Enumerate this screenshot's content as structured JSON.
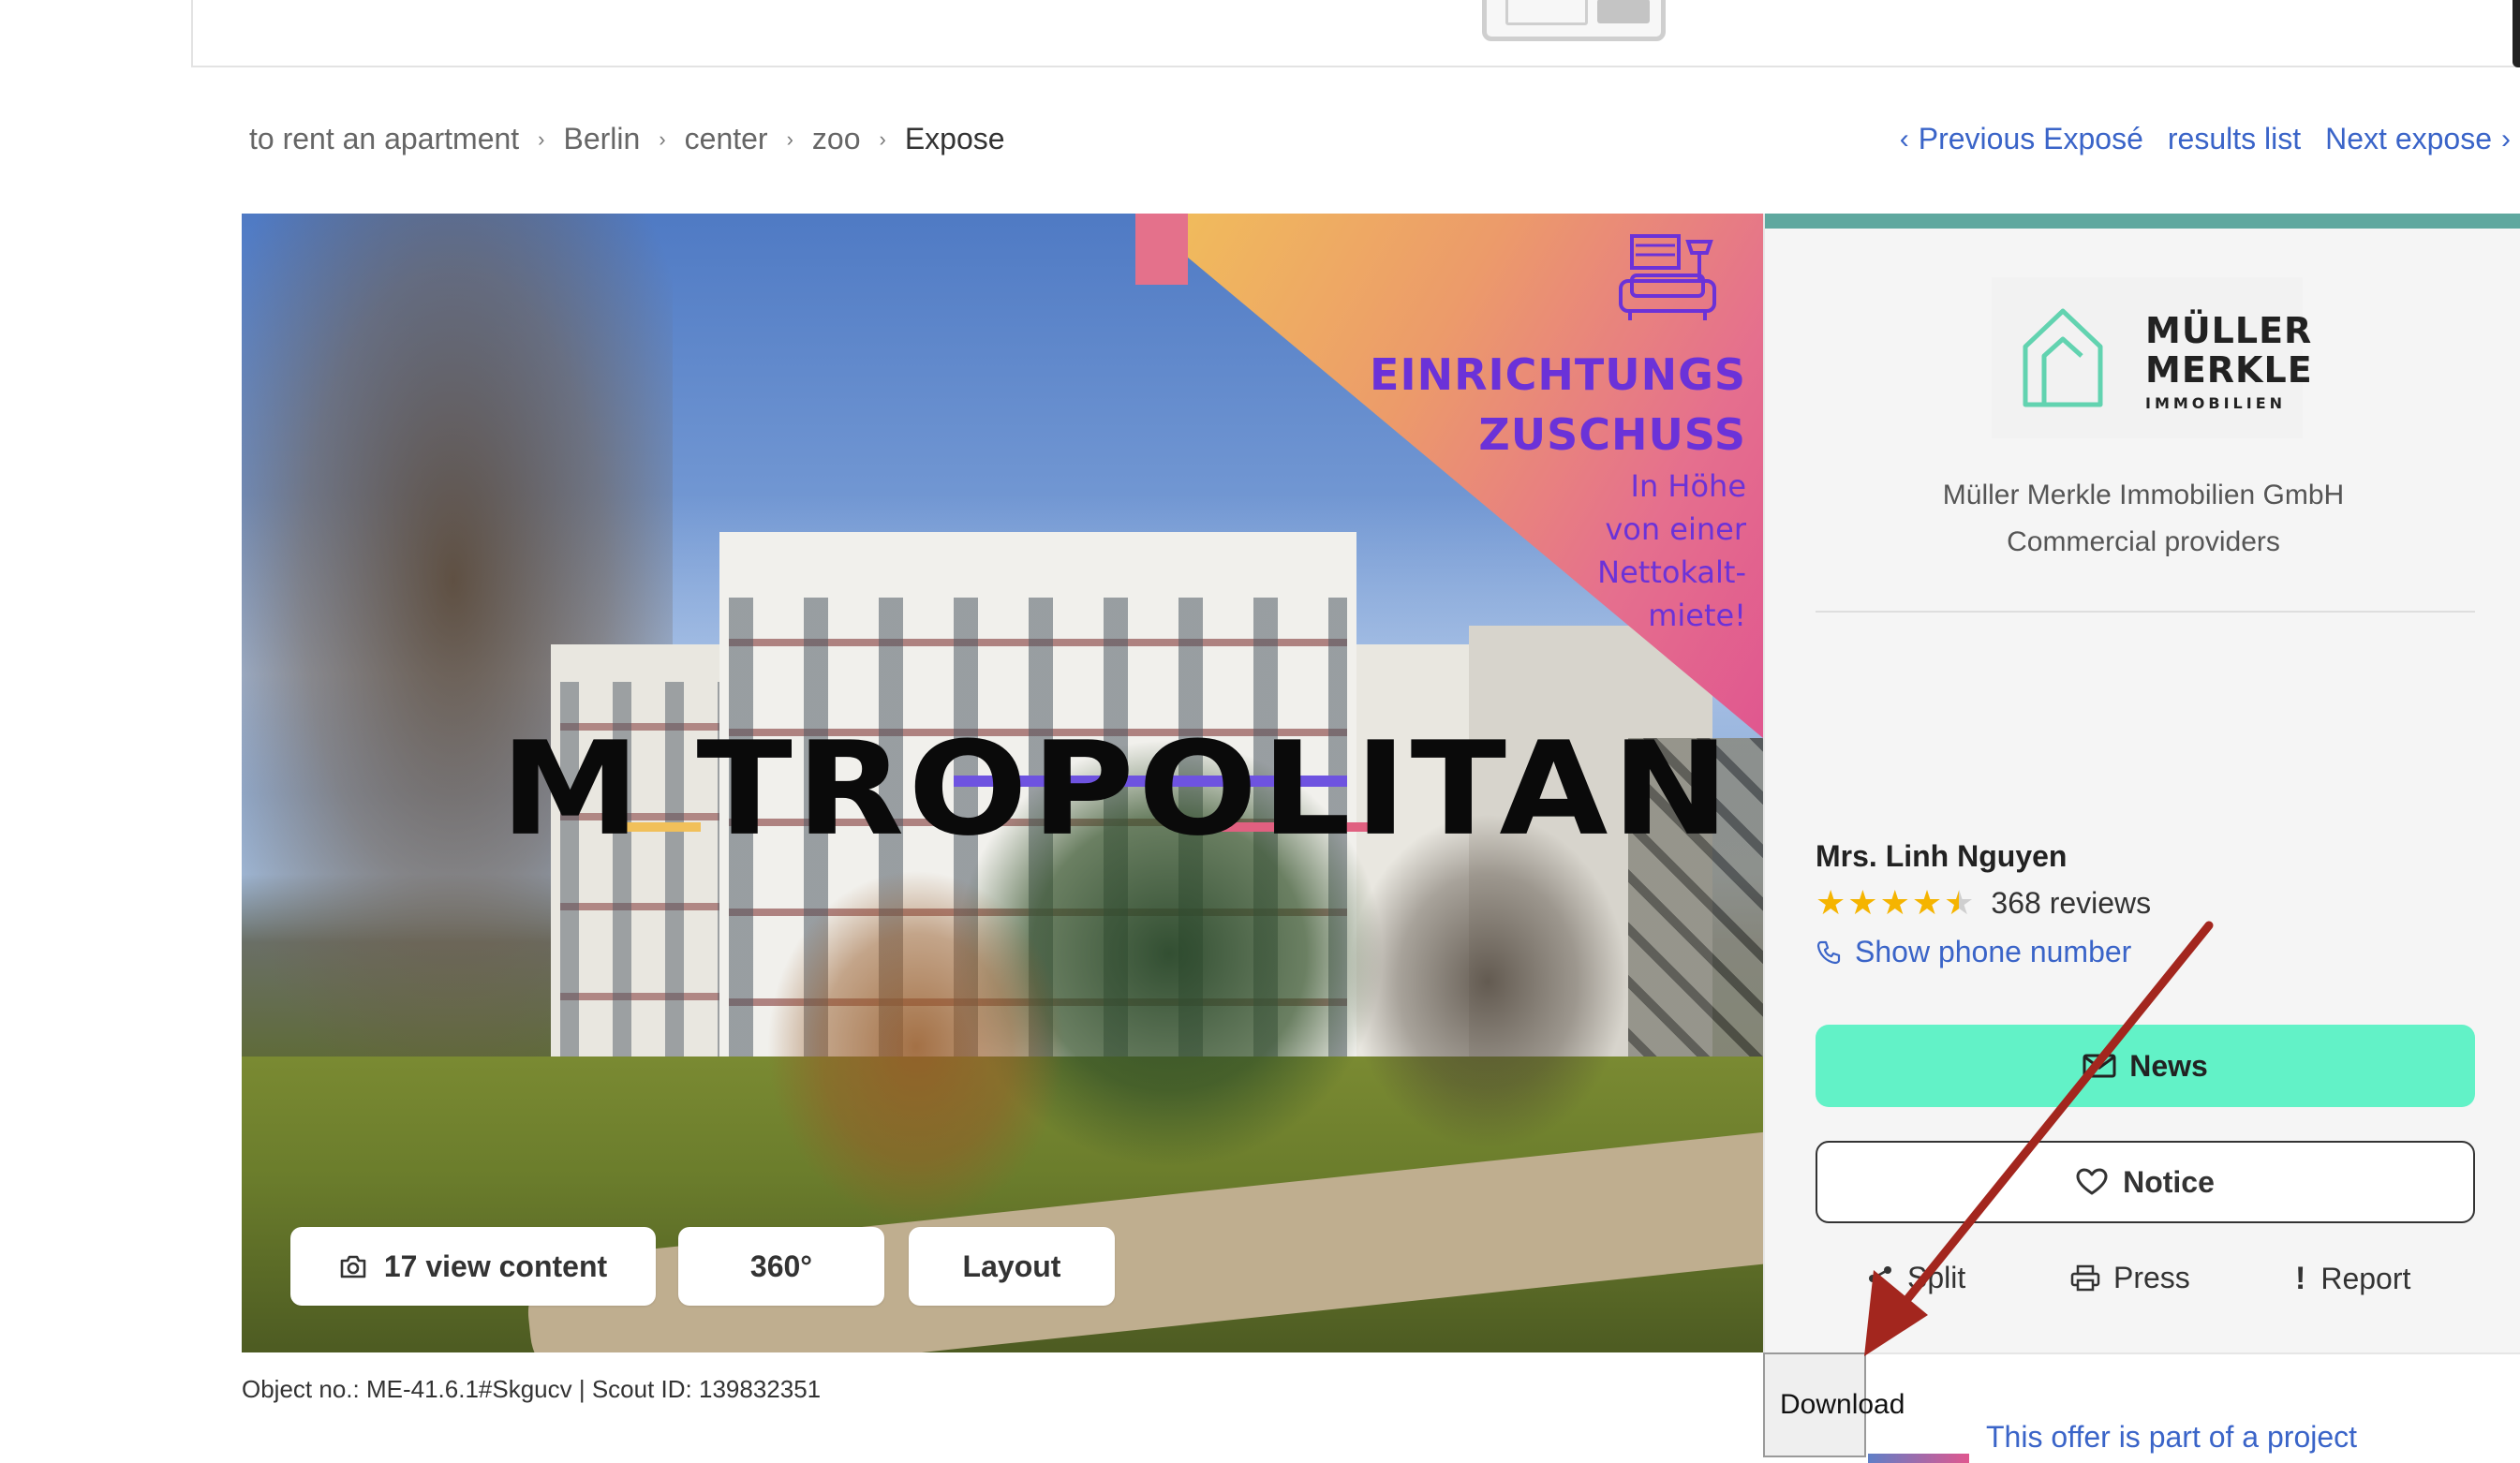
{
  "breadcrumb": {
    "items": [
      {
        "label": "to rent an apartment"
      },
      {
        "label": "Berlin"
      },
      {
        "label": "center"
      },
      {
        "label": "zoo"
      },
      {
        "label": "Expose"
      }
    ],
    "separator": "›"
  },
  "expose_nav": {
    "previous": "Previous Exposé",
    "results": "results list",
    "next": "Next expose",
    "prev_icon": "chevron-left-icon",
    "next_icon": "chevron-right-icon"
  },
  "gallery": {
    "promo_title_1": "EINRICHTUNGS",
    "promo_title_2": "ZUSCHUSS",
    "promo_sub_1": "In Höhe",
    "promo_sub_2": "von einer",
    "promo_sub_3": "Nettokalt-",
    "promo_sub_4": "miete!",
    "brand_text": "M TROPOLITAN",
    "buttons": {
      "view_content": "17 view content",
      "tour360": "360°",
      "layout": "Layout"
    },
    "camera_icon": "camera-icon"
  },
  "object_info": "Object no.: ME-41.6.1#Skgucv | Scout ID: 139832351",
  "contact": {
    "logo": {
      "line1": "MÜLLER",
      "line2": "MERKLE",
      "line3": "IMMOBILIEN"
    },
    "company_name": "Müller Merkle Immobilien GmbH",
    "provider_type": "Commercial providers",
    "agent_name": "Mrs. Linh Nguyen",
    "rating_stars": 4.5,
    "reviews": "368 reviews",
    "show_phone": "Show phone number",
    "news_button": "News",
    "notice_button": "Notice",
    "actions": {
      "split": "Split",
      "press": "Press",
      "report": "Report"
    }
  },
  "download_button": "Download",
  "project_link": "This offer is part of a project",
  "colors": {
    "accent_teal": "#5fa89f",
    "news_green": "#62f2c7",
    "link_blue": "#3a64c8",
    "promo_purple": "#6b32d8",
    "annotation_red": "#a3261e",
    "star_gold": "#f5b400"
  }
}
